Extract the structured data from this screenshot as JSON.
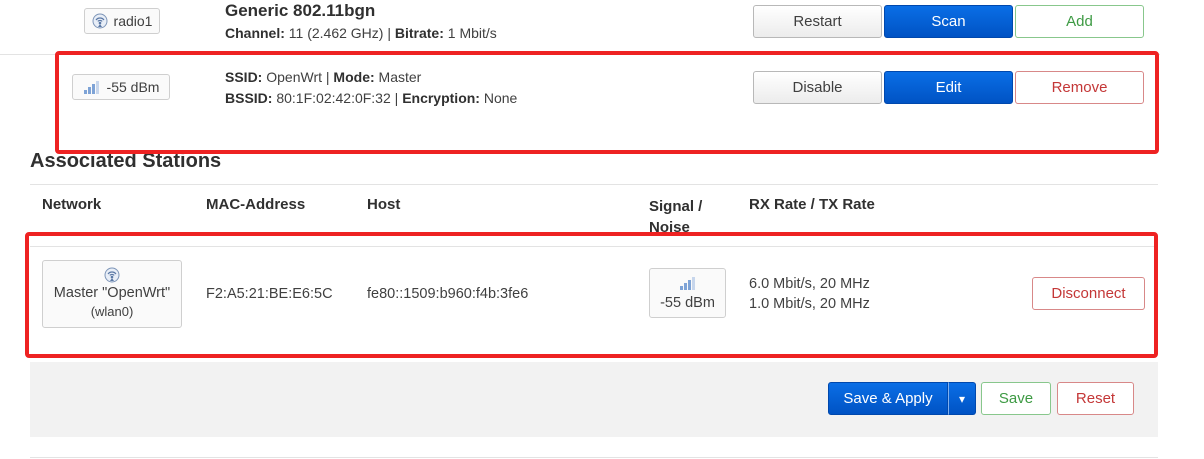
{
  "device": {
    "radio_label": "radio1",
    "title": "Generic 802.11bgn",
    "channel_label": "Channel:",
    "channel_value": "11 (2.462 GHz) |",
    "bitrate_label": "Bitrate:",
    "bitrate_value": "1 Mbit/s",
    "buttons": {
      "restart": "Restart",
      "scan": "Scan",
      "add": "Add"
    }
  },
  "network": {
    "signal": "-55 dBm",
    "ssid_label": "SSID:",
    "ssid_value": "OpenWrt |",
    "mode_label": "Mode:",
    "mode_value": "Master",
    "bssid_label": "BSSID:",
    "bssid_value": "80:1F:02:42:0F:32 |",
    "encryption_label": "Encryption:",
    "encryption_value": "None",
    "buttons": {
      "disable": "Disable",
      "edit": "Edit",
      "remove": "Remove"
    }
  },
  "stations": {
    "heading": "Associated Stations",
    "columns": {
      "network": "Network",
      "mac": "MAC-Address",
      "host": "Host",
      "signal_line1": "Signal /",
      "signal_line2": "Noise",
      "rate": "RX Rate / TX Rate"
    },
    "row": {
      "network_name": "Master \"OpenWrt\"",
      "network_iface": "(wlan0)",
      "mac": "F2:A5:21:BE:E6:5C",
      "host": "fe80::1509:b960:f4b:3fe6",
      "signal": "-55 dBm",
      "rx_rate": "6.0 Mbit/s, 20 MHz",
      "tx_rate": "1.0 Mbit/s, 20 MHz",
      "disconnect": "Disconnect"
    }
  },
  "footer": {
    "save_apply": "Save & Apply",
    "dropdown_arrow": "▾",
    "save": "Save",
    "reset": "Reset"
  },
  "colors": {
    "primary": "#0055cc",
    "positive": "#3d9a43",
    "negative": "#c43737",
    "highlight": "#ee2222"
  },
  "icons": {
    "radio": "wifi-radio-icon",
    "signal": "signal-strength-icon",
    "dropdown": "chevron-down-icon"
  }
}
